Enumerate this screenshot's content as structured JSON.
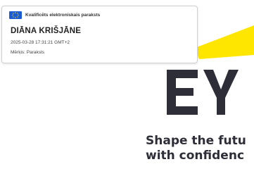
{
  "signature": {
    "badge": "Kvalificēts elektroniskais paraksts",
    "name": "DIĀNA KRIŠJĀNE",
    "datetime": "2025-03-28 17:31:21 GMT+2",
    "purpose": "Mērķis: Paraksts"
  },
  "brand": {
    "logo_text": "EY",
    "tagline_line1": "Shape the futu",
    "tagline_line2": "with confidenc",
    "colors": {
      "yellow": "#ffe600",
      "dark": "#2e2e38",
      "eu_blue": "#003399"
    }
  },
  "icons": {
    "badge_icon": "eu-flag-icon",
    "logo": "ey-logo"
  }
}
